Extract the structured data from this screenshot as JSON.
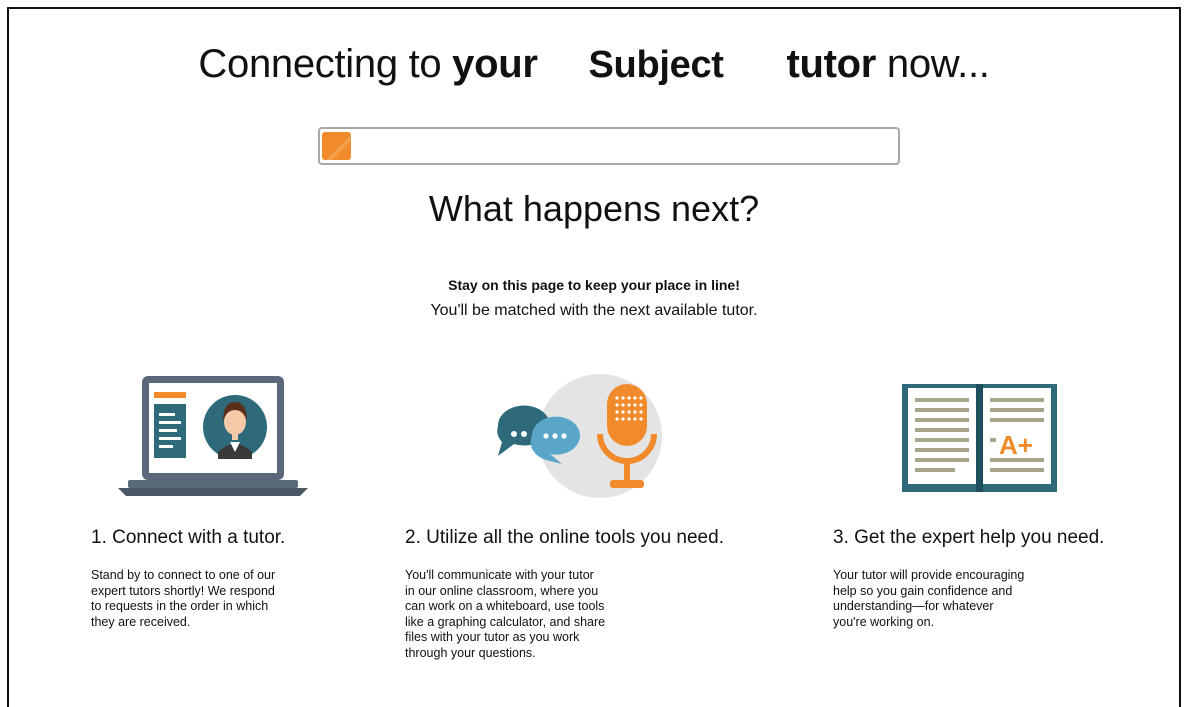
{
  "header": {
    "prefix": "Connecting to",
    "your": "your",
    "subject": "Subject",
    "tutor": "tutor",
    "suffix": "now..."
  },
  "progress": {
    "value_percent": 5,
    "color": "#f08a2b"
  },
  "next": {
    "heading": "What happens next?",
    "stay": "Stay on this page to keep your place in line!",
    "matched": "You'll be matched with the next available tutor."
  },
  "steps": [
    {
      "icon": "laptop-tutor-icon",
      "title": "1. Connect with a tutor.",
      "lines": [
        "Stand by to connect to one of our",
        "expert tutors shortly! We respond",
        "to requests in the order in which",
        "they are received."
      ]
    },
    {
      "icon": "chat-microphone-icon",
      "title": "2. Utilize all the online tools you need.",
      "lines": [
        "You'll communicate with your tutor",
        "in our online classroom, where you",
        "can work on a whiteboard, use tools",
        "like a graphing calculator, and share",
        "files with your tutor as you work",
        "through your questions."
      ]
    },
    {
      "icon": "book-a-plus-icon",
      "title": "3. Get the expert help you need.",
      "lines": [
        "Your tutor will provide encouraging",
        "help so you gain confidence and",
        "understanding—for whatever",
        "you're working on."
      ]
    }
  ],
  "colors": {
    "accent": "#f08a2b",
    "teal": "#2e6a7a",
    "slate": "#5a6a7a"
  },
  "grade_text": "A+"
}
